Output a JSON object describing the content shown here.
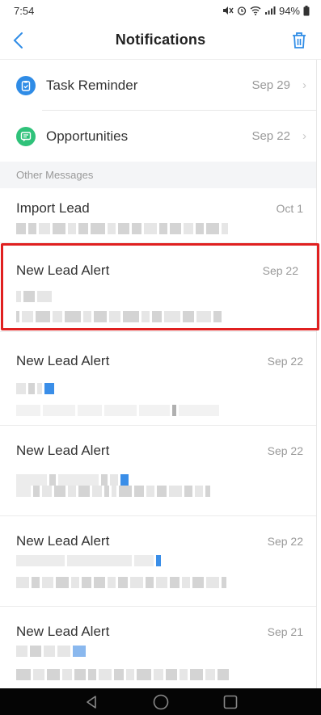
{
  "status": {
    "time": "7:54",
    "battery": "94%"
  },
  "header": {
    "title": "Notifications"
  },
  "categories": [
    {
      "label": "Task Reminder",
      "date": "Sep 29",
      "icon": "clipboard-icon",
      "color": "#2f8ce6"
    },
    {
      "label": "Opportunities",
      "date": "Sep 22",
      "icon": "chat-icon",
      "color": "#2fc27a"
    }
  ],
  "section": {
    "label": "Other Messages"
  },
  "messages": [
    {
      "title": "Import Lead",
      "date": "Oct 1"
    },
    {
      "title": "New Lead Alert",
      "date": "Sep 22"
    },
    {
      "title": "New Lead Alert",
      "date": "Sep 22"
    },
    {
      "title": "New Lead Alert",
      "date": "Sep 22"
    },
    {
      "title": "New Lead Alert",
      "date": "Sep 22"
    },
    {
      "title": "New Lead Alert",
      "date": "Sep 21"
    }
  ],
  "colors": {
    "accent": "#2f8ce6",
    "highlight": "#e02020"
  }
}
